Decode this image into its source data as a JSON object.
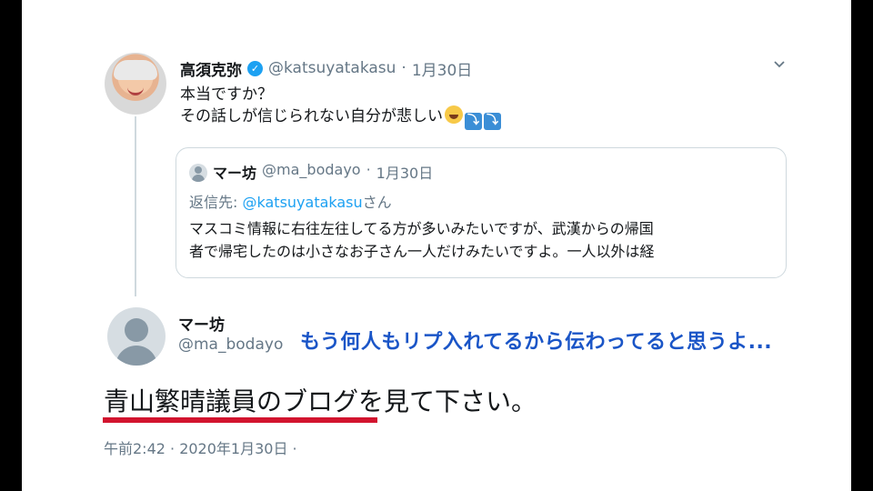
{
  "original_tweet": {
    "display_name": "高須克弥",
    "verified_icon": "verified-badge-icon",
    "handle": "@katsuyatakasu",
    "separator": "·",
    "date": "1月30日",
    "text_line1": "本当ですか？",
    "text_line2": "その話しが信じられない自分が悲しい",
    "emojis": [
      "crying-face-emoji",
      "arrow-emoji",
      "arrow-emoji"
    ],
    "menu_icon": "chevron-down-icon"
  },
  "quoted_tweet": {
    "display_name": "マー坊",
    "handle": "@ma_bodayo",
    "separator": "·",
    "date": "1月30日",
    "reply_prefix": "返信先:",
    "reply_handle": "@katsuyatakasu",
    "reply_suffix": "さん",
    "text_line1": "マスコミ情報に右往左往してる方が多いみたいですが、武漢からの帰国",
    "text_line2": "者で帰宅したのは小さなお子さん一人だけみたいですよ。一人以外は経"
  },
  "reply_tweet": {
    "display_name": "マー坊",
    "handle": "@ma_bodayo",
    "text": "青山繁晴議員のブログを見て下さい。",
    "timestamp": "午前2:42 · 2020年1月30日 ·"
  },
  "overlay_caption": "もう何人もリプ入れてるから伝わってると思うよ...",
  "colors": {
    "link_blue": "#1da1f2",
    "caption_blue": "#1a55c7",
    "underline_red": "#d2142f",
    "muted_gray": "#657786"
  }
}
